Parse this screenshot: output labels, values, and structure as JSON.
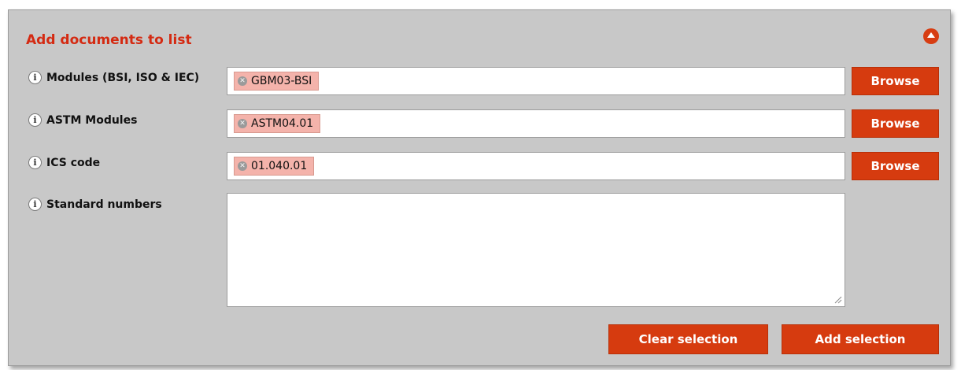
{
  "panel": {
    "title": "Add documents to list",
    "collapse_icon": "collapse-up-icon"
  },
  "rows": [
    {
      "label": "Modules (BSI, ISO & IEC)",
      "tag": "GBM03-BSI",
      "browse_label": "Browse"
    },
    {
      "label": "ASTM Modules",
      "tag": "ASTM04.01",
      "browse_label": "Browse"
    },
    {
      "label": "ICS code",
      "tag": "01.040.01",
      "browse_label": "Browse"
    }
  ],
  "standard_numbers": {
    "label": "Standard numbers",
    "value": ""
  },
  "actions": {
    "clear_label": "Clear selection",
    "add_label": "Add selection"
  },
  "info_icon_glyph": "i",
  "tag_remove_glyph": "✕",
  "colors": {
    "panel_bg": "#c8c8c8",
    "accent": "#d63b0f",
    "title": "#d42a12",
    "tag_bg": "#f4b3ab"
  }
}
